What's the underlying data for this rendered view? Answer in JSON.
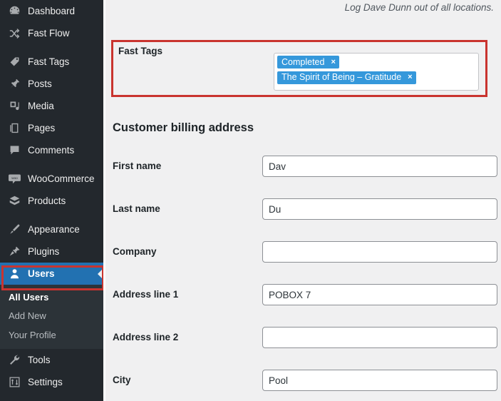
{
  "sidebar": {
    "items": [
      {
        "label": "Dashboard",
        "icon": "dashboard-icon",
        "current": false
      },
      {
        "label": "Fast Flow",
        "icon": "shuffle-icon",
        "current": false
      },
      {
        "label": "Fast Tags",
        "icon": "tag-icon",
        "current": false
      },
      {
        "label": "Posts",
        "icon": "pin-icon",
        "current": false
      },
      {
        "label": "Media",
        "icon": "media-icon",
        "current": false
      },
      {
        "label": "Pages",
        "icon": "pages-icon",
        "current": false
      },
      {
        "label": "Comments",
        "icon": "comments-icon",
        "current": false
      },
      {
        "label": "WooCommerce",
        "icon": "woocommerce-icon",
        "current": false
      },
      {
        "label": "Products",
        "icon": "products-box-icon",
        "current": false
      },
      {
        "label": "Appearance",
        "icon": "appearance-brush-icon",
        "current": false
      },
      {
        "label": "Plugins",
        "icon": "plugins-plug-icon",
        "current": false
      },
      {
        "label": "Users",
        "icon": "users-icon",
        "current": true
      },
      {
        "label": "Tools",
        "icon": "tools-wrench-icon",
        "current": false
      },
      {
        "label": "Settings",
        "icon": "settings-sliders-icon",
        "current": false
      }
    ],
    "submenu": [
      {
        "label": "All Users",
        "current": true
      },
      {
        "label": "Add New",
        "current": false
      },
      {
        "label": "Your Profile",
        "current": false
      }
    ]
  },
  "content": {
    "logout_note": "Log Dave Dunn out of all locations.",
    "fast_tags": {
      "label": "Fast Tags",
      "tags": [
        {
          "label": "Completed",
          "remove": "×"
        },
        {
          "label": "The Spirit of Being – Gratitude",
          "remove": "×"
        }
      ]
    },
    "billing": {
      "title": "Customer billing address",
      "fields": [
        {
          "label": "First name",
          "value": "Dav"
        },
        {
          "label": "Last name",
          "value": "Du"
        },
        {
          "label": "Company",
          "value": ""
        },
        {
          "label": "Address line 1",
          "value": "POBOX 7"
        },
        {
          "label": "Address line 2",
          "value": ""
        },
        {
          "label": "City",
          "value": "Pool"
        }
      ]
    }
  },
  "colors": {
    "sidebar_bg": "#23282d",
    "submenu_bg": "#2c3338",
    "active_blue": "#2271b1",
    "tag_blue": "#3598db",
    "annotation_red": "#c9342f",
    "content_bg": "#f0f0f1"
  }
}
